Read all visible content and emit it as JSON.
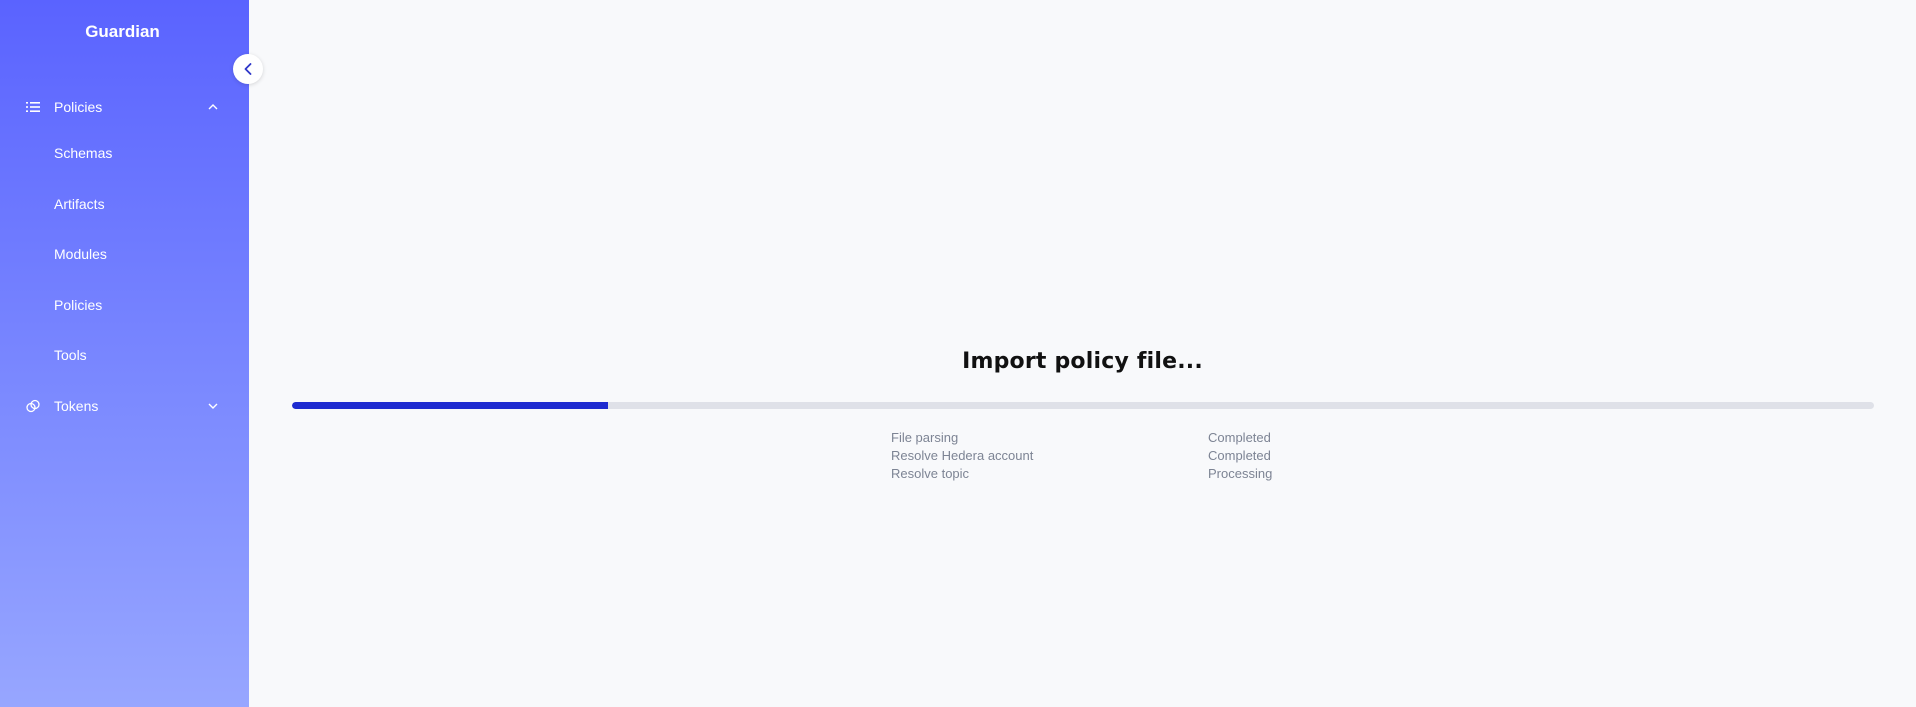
{
  "app": {
    "brand": "Guardian"
  },
  "sidebar": {
    "items": [
      {
        "label": "Policies",
        "icon": "list-icon",
        "expandable": true,
        "expanded": true
      },
      {
        "label": "Schemas"
      },
      {
        "label": "Artifacts"
      },
      {
        "label": "Modules"
      },
      {
        "label": "Policies"
      },
      {
        "label": "Tools"
      },
      {
        "label": "Tokens",
        "icon": "tokens-icon",
        "expandable": true,
        "expanded": false
      }
    ]
  },
  "main": {
    "title": "Import policy file...",
    "progress": 0.2,
    "steps": [
      {
        "name": "File parsing",
        "status": "Completed"
      },
      {
        "name": "Resolve Hedera account",
        "status": "Completed"
      },
      {
        "name": "Resolve topic",
        "status": "Processing"
      }
    ]
  },
  "colors": {
    "sidebar_top": "#5a63ff",
    "sidebar_bottom": "#97a6ff",
    "progress_fill": "#1e2bd0",
    "progress_track": "#dfe1e8",
    "background": "#f8f9fb"
  }
}
